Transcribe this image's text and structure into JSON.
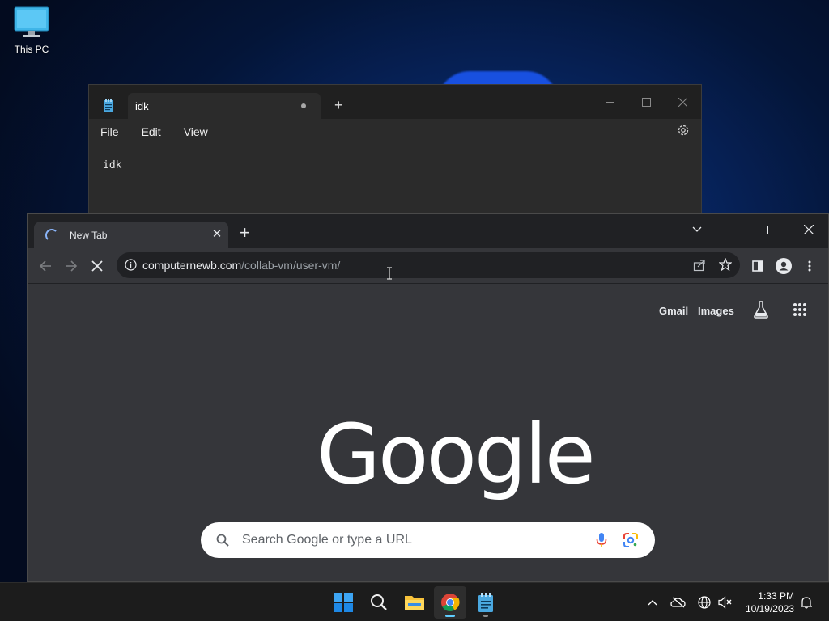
{
  "desktop": {
    "icons": [
      {
        "label": "This PC",
        "icon": "monitor-icon"
      }
    ]
  },
  "notepad": {
    "tab_title": "idk",
    "menu": [
      "File",
      "Edit",
      "View"
    ],
    "content": "idk"
  },
  "chrome": {
    "tab_title": "New Tab",
    "url_host": "computernewb.com",
    "url_path": "/collab-vm/user-vm/",
    "links": {
      "gmail": "Gmail",
      "images": "Images"
    },
    "logo_text": "Google",
    "search_placeholder": "Search Google or type a URL"
  },
  "taskbar": {
    "apps": [
      "start-icon",
      "search-icon",
      "file-explorer-icon",
      "chrome-icon",
      "notepad-icon"
    ],
    "time": "1:33 PM",
    "date": "10/19/2023"
  },
  "colors": {
    "chrome_bg": "#35363a",
    "chrome_tabstrip": "#202124",
    "notepad_bg": "#2b2b2b",
    "taskbar_bg": "#1c1c1c",
    "accent": "#60cdff"
  }
}
